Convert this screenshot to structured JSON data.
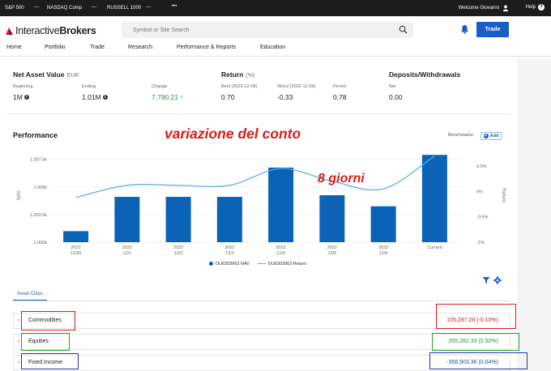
{
  "ticker": {
    "items": [
      "S&P 500",
      "NASDAQ Comp",
      "RUSSELL 1000"
    ],
    "more": "•••",
    "welcome": "Welcome Giovanni",
    "help": "Help"
  },
  "header": {
    "logo_prefix": "Interactive",
    "logo_bold": "Brokers",
    "search_placeholder": "Symbol or Site Search",
    "trade_label": "Trade"
  },
  "nav": [
    "Home",
    "Portfolio",
    "Trade",
    "Research",
    "Performance & Reports",
    "Education"
  ],
  "summary": {
    "nav": {
      "title": "Net Asset Value",
      "currency": "EUR",
      "beginning_label": "Beginning",
      "beginning_value": "1M",
      "ending_label": "Ending",
      "ending_value": "1.01M",
      "change_label": "Change",
      "change_value": "7,790.21"
    },
    "return": {
      "title": "Return",
      "unit": "(%)",
      "best_label": "Best (2022-12-08)",
      "best_value": "0.70",
      "worst_label": "Worst (2022-12-06)",
      "worst_value": "-0.33",
      "period_label": "Period",
      "period_value": "0.78"
    },
    "deposits": {
      "title": "Deposits/Withdrawals",
      "net_label": "Net",
      "net_value": "0.00"
    }
  },
  "performance": {
    "title": "Performance",
    "benchmarks_label": "Benchmarks:",
    "add_label": "Add",
    "annotation_1": "variazione del conto",
    "annotation_2": "8 giorni"
  },
  "chart_data": {
    "type": "bar",
    "categories": [
      [
        "2022",
        "11/30"
      ],
      [
        "2022",
        "12/1"
      ],
      [
        "2022",
        "12/2"
      ],
      [
        "2022",
        "12/3"
      ],
      [
        "2022",
        "12/4"
      ],
      [
        "2022",
        "12/5"
      ],
      [
        "2022",
        "12/6"
      ],
      [
        "Current"
      ]
    ],
    "values": [
      1001000,
      1004100,
      1004100,
      1004100,
      1006750,
      1004250,
      1003250,
      1007900
    ],
    "return_series": [
      -0.12,
      0.12,
      0.12,
      0.12,
      0.45,
      0.2,
      0.05,
      0.7
    ],
    "left_ticks": [
      "1.007.5k",
      "1.005k",
      "1.002.5k",
      "1.000k"
    ],
    "left_tick_values": [
      1007500,
      1005000,
      1002500,
      1000000
    ],
    "right_ticks": [
      "0.5%",
      "0%",
      "-0.5%",
      "-1%"
    ],
    "right_tick_values": [
      0.5,
      0,
      -0.5,
      -1
    ],
    "ylim": [
      1000000,
      1008500
    ],
    "ylim_right": [
      -1,
      0.85
    ],
    "ylabel": "NAV",
    "ylabel_right": "Return",
    "legend": [
      "DU6303963 NAV",
      "DU6303963 Return"
    ],
    "colors": {
      "bar": "#0b63b8",
      "line": "#5aaae0"
    }
  },
  "asset_class": {
    "tab_label": "Asset Class",
    "rows": [
      {
        "name": "Commodities",
        "amount": "105,287.28 (-0.10%)",
        "color": "#cc1f1f"
      },
      {
        "name": "Equities",
        "amount": "265,282.33 (0.50%)",
        "color": "#1f9b3a"
      },
      {
        "name": "Fixed Income",
        "amount": "-356,903.36 (0.04%)",
        "color": "#1a4fb5"
      }
    ]
  }
}
